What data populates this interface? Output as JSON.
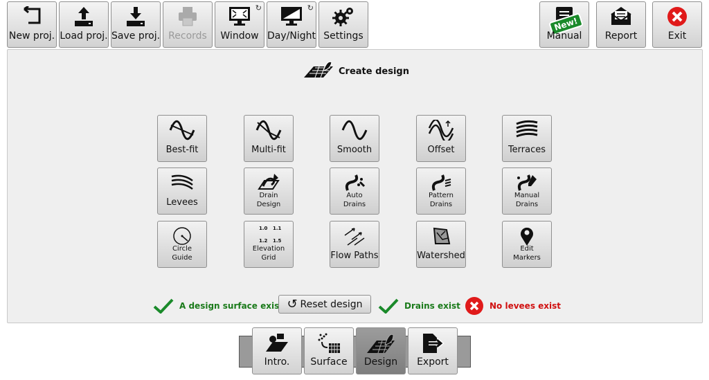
{
  "toolbar": {
    "new_proj": "New proj.",
    "load_proj": "Load proj.",
    "save_proj": "Save proj.",
    "records": "Records",
    "window": "Window",
    "day_night": "Day/Night",
    "settings": "Settings",
    "manual": "Manual",
    "manual_badge": "New!",
    "report": "Report",
    "exit": "Exit"
  },
  "panel": {
    "title": "Create design",
    "buttons": [
      {
        "label": "Best-fit",
        "icon": "sine-curve-icon"
      },
      {
        "label": "Multi-fit",
        "icon": "multi-curve-icon"
      },
      {
        "label": "Smooth",
        "icon": "smooth-curve-icon"
      },
      {
        "label": "Offset",
        "icon": "offset-curve-icon"
      },
      {
        "label": "Terraces",
        "icon": "terraces-icon"
      },
      {
        "label": "Levees",
        "icon": "levees-icon"
      },
      {
        "label": "Drain Design",
        "icon": "drain-design-icon"
      },
      {
        "label": "Auto Drains",
        "icon": "auto-drains-icon"
      },
      {
        "label": "Pattern Drains",
        "icon": "pattern-drains-icon"
      },
      {
        "label": "Manual Drains",
        "icon": "manual-drains-icon"
      },
      {
        "label": "Circle Guide",
        "icon": "circle-guide-icon"
      },
      {
        "label": "Elevation Grid",
        "icon": "elevation-grid-icon"
      },
      {
        "label": "Flow Paths",
        "icon": "flow-paths-icon"
      },
      {
        "label": "Watershed",
        "icon": "watershed-icon"
      },
      {
        "label": "Edit Markers",
        "icon": "map-marker-icon"
      }
    ],
    "elev_values": [
      "1.0",
      "1.1",
      "1.2",
      "1.5"
    ],
    "status": {
      "surface": "A design surface exists",
      "reset": "Reset design",
      "drains": "Drains exist",
      "levees": "No levees exist"
    }
  },
  "nav": {
    "intro": "Intro.",
    "surface": "Surface",
    "design": "Design",
    "export": "Export"
  },
  "colors": {
    "ok": "#1a7a1a",
    "bad": "#d01010",
    "badge": "#1a8a2a"
  }
}
